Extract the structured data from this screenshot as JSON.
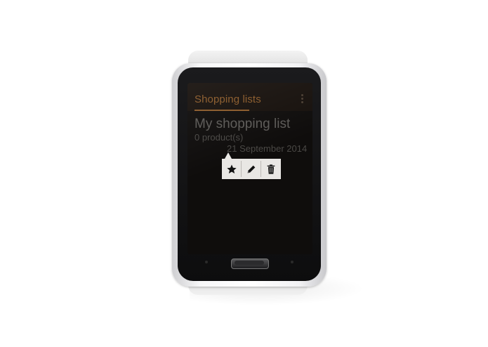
{
  "app": {
    "title": "Shopping lists",
    "overflow_icon": "overflow-menu-icon"
  },
  "list_item": {
    "name": "My shopping list",
    "count": "0 product(s)",
    "date": "21 September 2014"
  },
  "popup": {
    "actions": [
      {
        "icon": "star-icon",
        "glyph": "★"
      },
      {
        "icon": "edit-pencil-icon",
        "glyph": "✎"
      },
      {
        "icon": "trash-icon",
        "glyph": "🗑"
      }
    ]
  },
  "colors": {
    "accent": "#8a5a2a",
    "screen_bg": "#0f0d0c",
    "popup_bg": "#e9e7e4"
  }
}
